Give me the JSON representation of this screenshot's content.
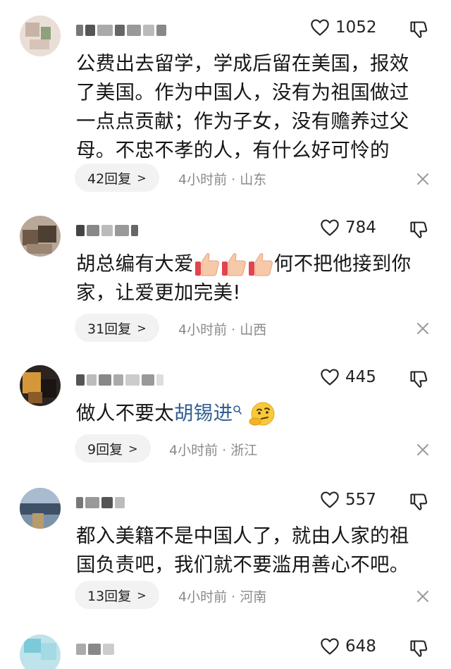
{
  "comments": [
    {
      "likes": "1052",
      "text": "公费出去留学，学成后留在美国，报效了美国。作为中国人，没有为祖国做过一点点贡献；作为子女，没有赡养过父母。不忠不孝的人，有什么好可怜的",
      "replies": "42回复",
      "time": "4小时前",
      "region": "山东"
    },
    {
      "likes": "784",
      "text_before": "胡总编有大爱",
      "text_after": "何不把他接到你家，让爱更加完美!",
      "replies": "31回复",
      "time": "4小时前",
      "region": "山西"
    },
    {
      "likes": "445",
      "text_before": "做人不要太",
      "link": "胡锡进",
      "replies": "9回复",
      "time": "4小时前",
      "region": "浙江"
    },
    {
      "likes": "557",
      "text": "都入美籍不是中国人了，就由人家的祖国负责吧，我们就不要滥用善心不吧。",
      "replies": "13回复",
      "time": "4小时前",
      "region": "河南"
    },
    {
      "likes": "648"
    }
  ],
  "meta_separator": "·",
  "chevron": ">",
  "icons": {
    "like": "heart-outline-icon",
    "dislike": "thumbs-down-icon",
    "close": "close-icon",
    "search": "search-icon",
    "emoji_thumbs": "thumbs-up-emoji",
    "emoji_thinking": "thinking-face-emoji"
  },
  "colors": {
    "link": "#2f5e8f",
    "meta": "#8a8a8a",
    "pill": "#f2f2f2"
  }
}
